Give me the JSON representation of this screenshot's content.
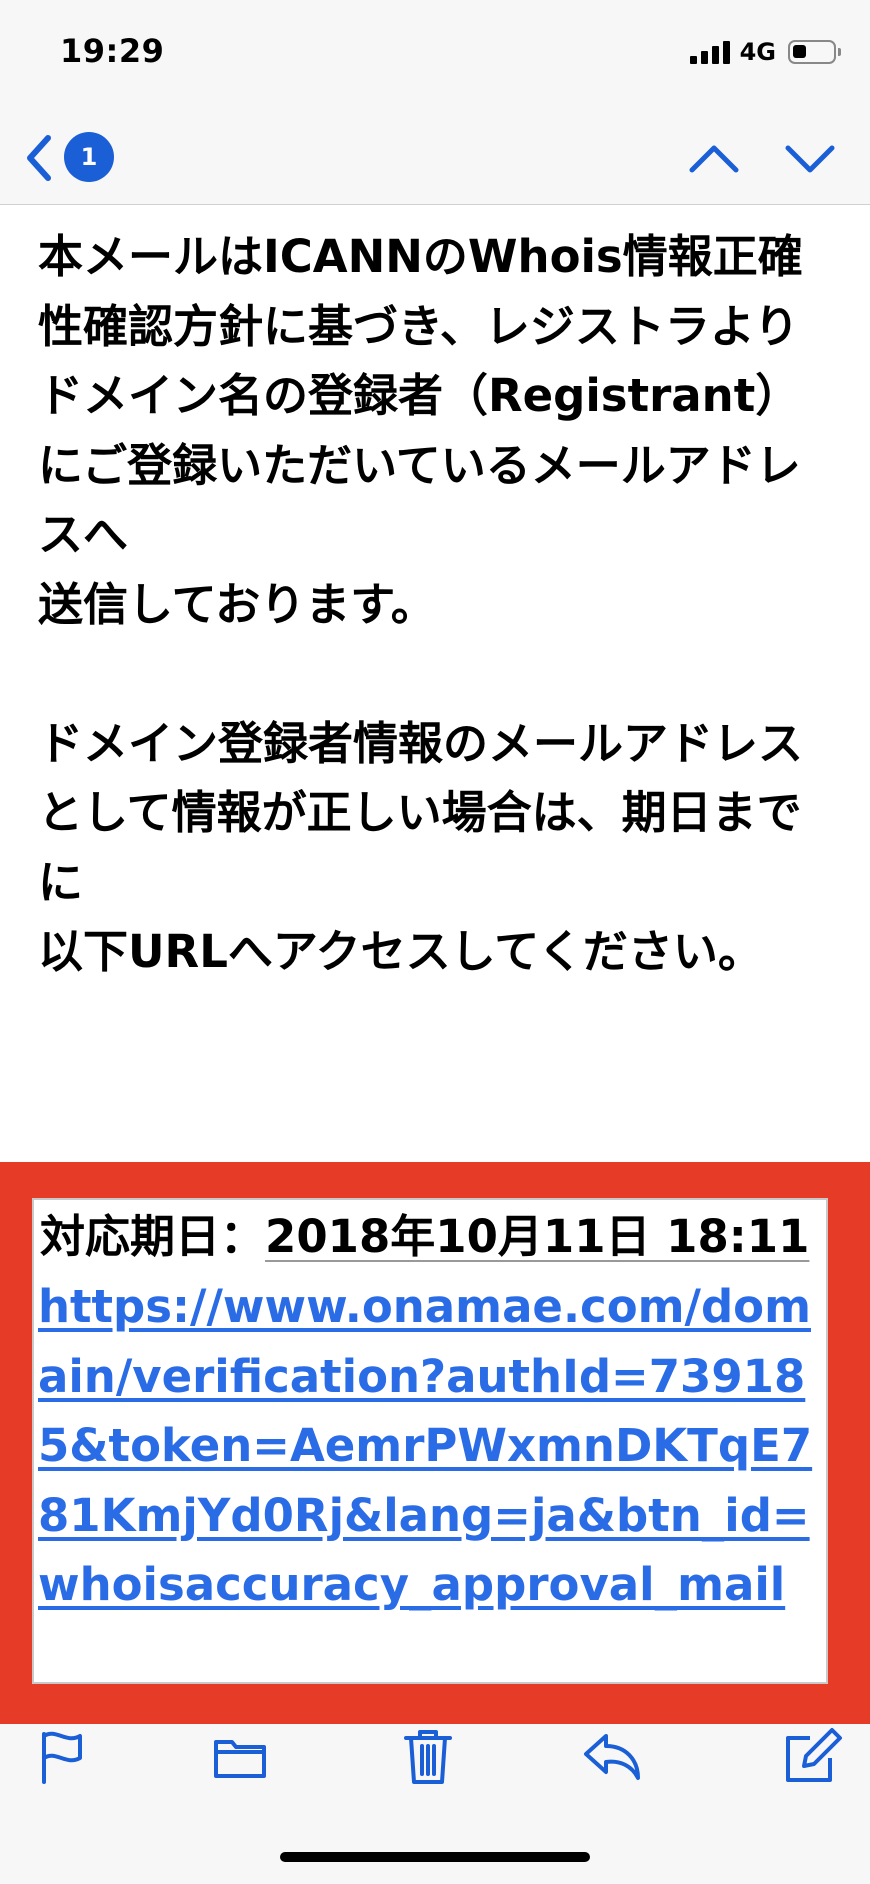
{
  "status_bar": {
    "time": "19:29",
    "network": "4G",
    "battery_level": 0.35
  },
  "nav": {
    "back_icon": "chevron-left-icon",
    "unread_count": "1",
    "prev_icon": "chevron-up-icon",
    "next_icon": "chevron-down-icon",
    "accent_color": "#1a5fd6"
  },
  "email": {
    "body": "本メールはICANNのWhois情報正確性確認方針に基づき、レジストラより\nドメイン名の登録者（Registrant）にご登録いただいているメールアドレスへ\n送信しております。\n\nドメイン登録者情報のメールアドレスとして情報が正しい場合は、期日までに\n以下URLへアクセスしてください。",
    "deadline_label": "対応期日：",
    "deadline_value": "2018年10月11日 18:11",
    "verification_url": "https://www.onamae.com/domain/verification?authId=739185&token=AemrPWxmnDKTqE781KmjYd0Rj&lang=ja&btn_id=whoisaccuracy_approval_mail",
    "highlight_color": "#e63c27",
    "link_color": "#2a6be6"
  },
  "toolbar": {
    "icons": [
      "flag-icon",
      "folder-icon",
      "trash-icon",
      "reply-icon",
      "compose-icon"
    ],
    "icon_color": "#1a5fd6"
  }
}
